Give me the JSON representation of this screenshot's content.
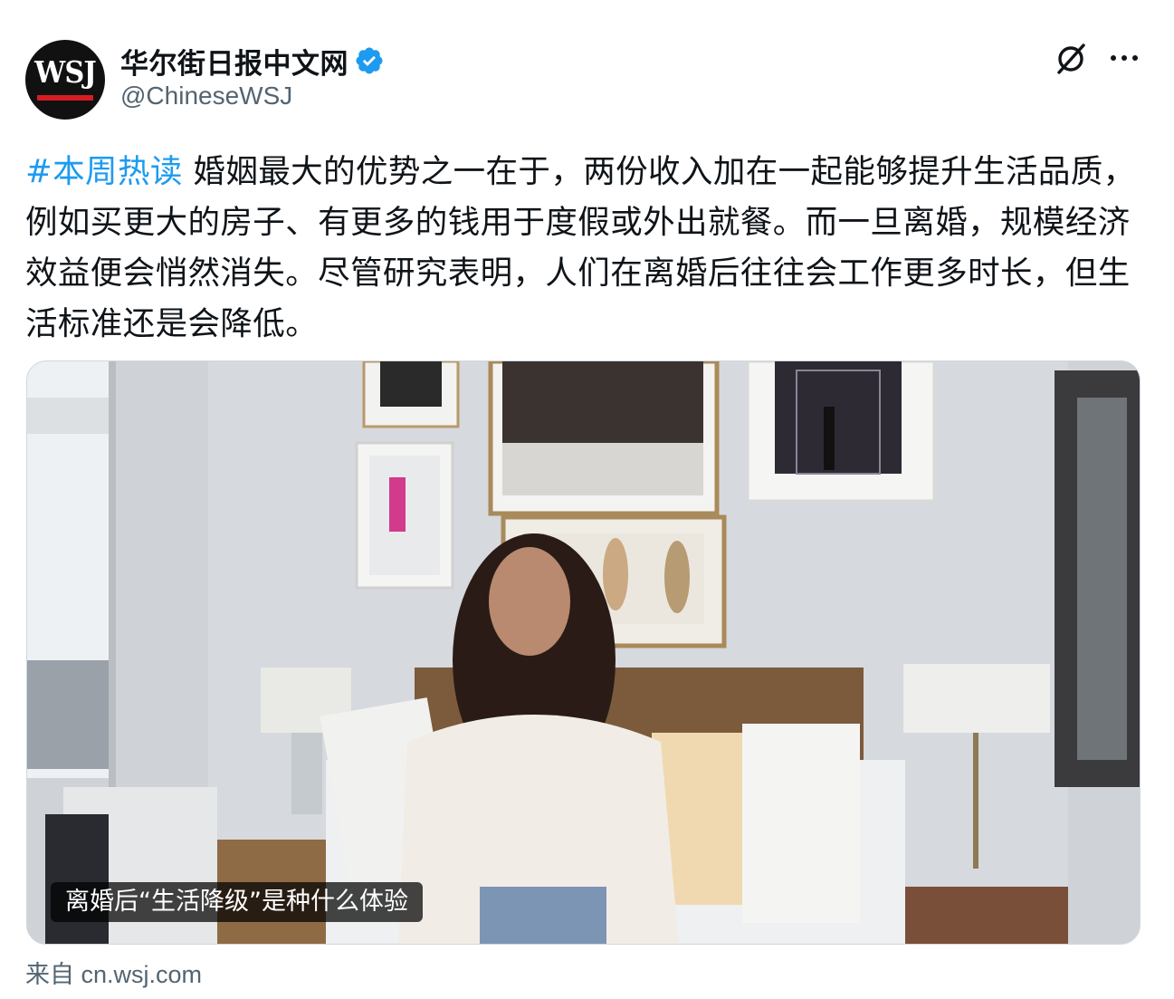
{
  "account": {
    "avatar_text": "WSJ",
    "display_name": "华尔街日报中文网",
    "handle": "@ChineseWSJ",
    "verified": true
  },
  "header_icons": [
    "grok-icon",
    "more-icon"
  ],
  "tweet": {
    "hashtag": "#本周热读",
    "body": " 婚姻最大的优势之一在于，两份收入加在一起能够提升生活品质，例如买更大的房子、有更多的钱用于度假或外出就餐。而一旦离婚，规模经济效益便会悄然消失。尽管研究表明，人们在离婚后往往会工作更多时长，但生活标准还是会降低。"
  },
  "card": {
    "caption": "离婚后“生活降级”是种什么体验",
    "source_prefix": "来自",
    "source_domain": "cn.wsj.com"
  },
  "colors": {
    "link": "#1d9bf0",
    "verified": "#1d9bf0",
    "secondary_text": "#536471",
    "wsj_red": "#d51d23"
  }
}
